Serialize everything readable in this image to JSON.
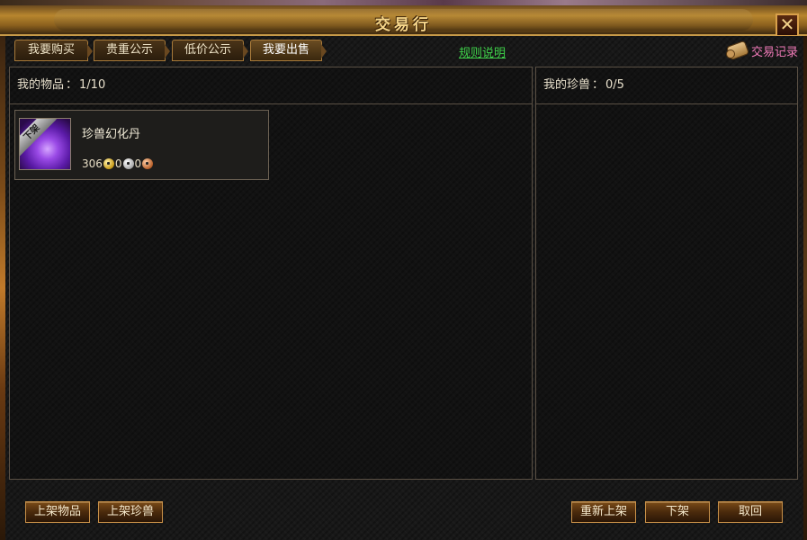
{
  "window": {
    "title": "交易行",
    "close_symbol": "✕"
  },
  "tabs": [
    {
      "label": "我要购买"
    },
    {
      "label": "贵重公示"
    },
    {
      "label": "低价公示"
    },
    {
      "label": "我要出售"
    }
  ],
  "rules_link": "规则说明",
  "trade_log": {
    "label": "交易记录",
    "icon": "scroll-icon"
  },
  "my_items": {
    "label": "我的物品",
    "separator": "：",
    "count": "1/10",
    "items": [
      {
        "name": "珍兽幻化丹",
        "badge": "下架",
        "price": {
          "gold": "306",
          "silver": "0",
          "copper": "0"
        }
      }
    ]
  },
  "my_pets": {
    "label": "我的珍兽",
    "separator": "：",
    "count": "0/5"
  },
  "buttons": {
    "list_item": "上架物品",
    "list_pet": "上架珍兽",
    "relist": "重新上架",
    "delist": "下架",
    "cancel": "取回"
  },
  "colors": {
    "title": "#f6d68a",
    "rules_link": "#3fd24a",
    "trade_log": "#f07ab8"
  }
}
